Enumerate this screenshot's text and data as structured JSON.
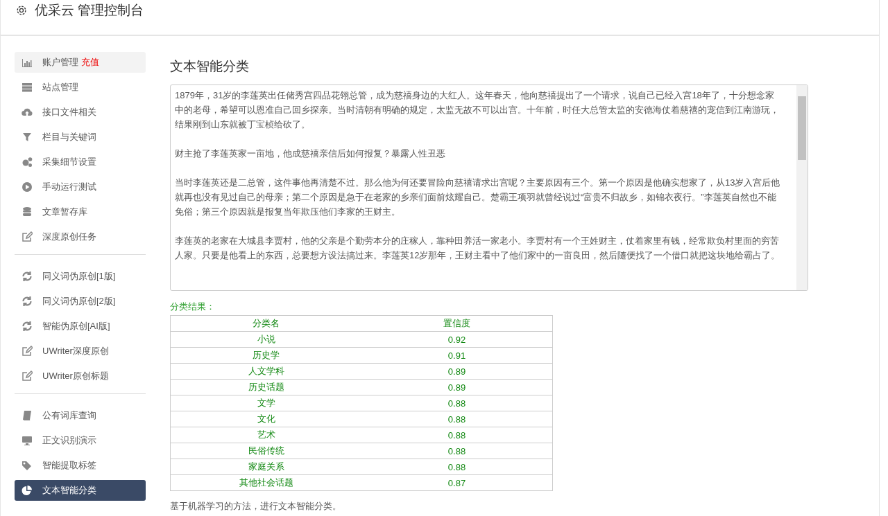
{
  "header": {
    "title": "优采云 管理控制台"
  },
  "sidebar": {
    "sections": [
      {
        "items": [
          {
            "label": "账户管理",
            "badge": "充值",
            "hovered": true,
            "selected": false
          },
          {
            "label": "站点管理",
            "hovered": false,
            "selected": false
          },
          {
            "label": "接口文件相关",
            "hovered": false,
            "selected": false
          },
          {
            "label": "栏目与关键词",
            "hovered": false,
            "selected": false
          },
          {
            "label": "采集细节设置",
            "hovered": false,
            "selected": false
          },
          {
            "label": "手动运行测试",
            "hovered": false,
            "selected": false
          },
          {
            "label": "文章暂存库",
            "hovered": false,
            "selected": false
          },
          {
            "label": "深度原创任务",
            "hovered": false,
            "selected": false
          }
        ]
      },
      {
        "items": [
          {
            "label": "同义词伪原创[1版]",
            "hovered": false,
            "selected": false
          },
          {
            "label": "同义词伪原创[2版]",
            "hovered": false,
            "selected": false
          },
          {
            "label": "智能伪原创[AI版]",
            "hovered": false,
            "selected": false
          },
          {
            "label": "UWriter深度原创",
            "hovered": false,
            "selected": false
          },
          {
            "label": "UWriter原创标题",
            "hovered": false,
            "selected": false
          }
        ]
      },
      {
        "items": [
          {
            "label": "公有词库查询",
            "hovered": false,
            "selected": false
          },
          {
            "label": "正文识别演示",
            "hovered": false,
            "selected": false
          },
          {
            "label": "智能提取标签",
            "hovered": false,
            "selected": false
          },
          {
            "label": "文本智能分类",
            "hovered": false,
            "selected": true
          }
        ]
      }
    ]
  },
  "main": {
    "title": "文本智能分类",
    "text_area": {
      "paragraphs": [
        "1879年，31岁的李莲英出任储秀宫四品花翎总管，成为慈禧身边的大红人。这年春天，他向慈禧提出了一个请求，说自己已经入宫18年了，十分想念家中的老母，希望可以恩准自己回乡探亲。当时清朝有明确的规定，太监无故不可以出宫。十年前，时任大总管太监的安德海仗着慈禧的宠信到江南游玩，结果刚到山东就被丁宝桢给砍了。",
        "财主抢了李莲英家一亩地，他成慈禧亲信后如何报复？暴露人性丑恶",
        "当时李莲英还是二总管，这件事他再清楚不过。那么他为何还要冒险向慈禧请求出宫呢？主要原因有三个。第一个原因是他确实想家了，从13岁入宫后他就再也没有见过自己的母亲；第二个原因是急于在老家的乡亲们面前炫耀自己。楚霸王项羽就曾经说过“富贵不归故乡，如锦衣夜行。”李莲英自然也不能免俗；第三个原因就是报复当年欺压他们李家的王财主。",
        "李莲英的老家在大城县李贾村，他的父亲是个勤劳本分的庄稼人，靠种田养活一家老小。李贾村有一个王姓财主，仗着家里有钱，经常欺负村里面的穷苦人家。只要是他看上的东西，总要想方设法搞过来。李莲英12岁那年，王财主看中了他们家中的一亩良田，然后随便找了一个借口就把这块地给霸占了。"
      ]
    },
    "result_label": "分类结果：",
    "table": {
      "columns": [
        "分类名",
        "置信度"
      ],
      "rows": [
        [
          "小说",
          "0.92"
        ],
        [
          "历史学",
          "0.91"
        ],
        [
          "人文学科",
          "0.89"
        ],
        [
          "历史话题",
          "0.89"
        ],
        [
          "文学",
          "0.88"
        ],
        [
          "文化",
          "0.88"
        ],
        [
          "艺术",
          "0.88"
        ],
        [
          "民俗传统",
          "0.88"
        ],
        [
          "家庭关系",
          "0.88"
        ],
        [
          "其他社会话题",
          "0.87"
        ]
      ]
    },
    "footer_note": "基于机器学习的方法，进行文本智能分类。"
  }
}
